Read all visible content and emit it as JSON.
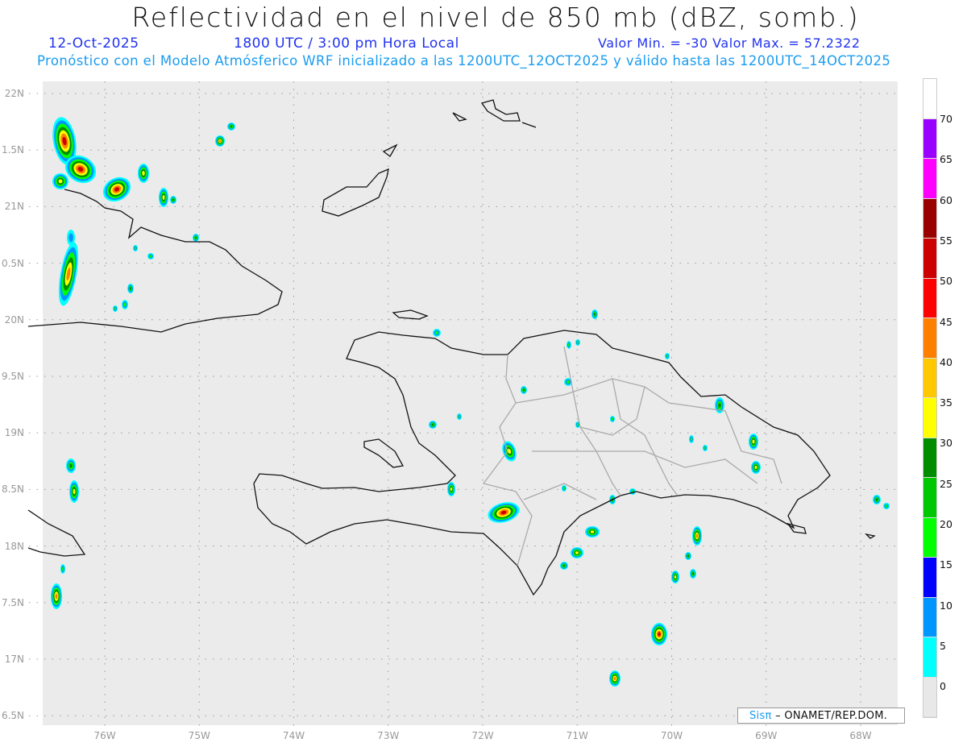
{
  "header": {
    "title": "Reflectividad en el nivel de 850 mb (dBZ, somb.)",
    "date": "12-Oct-2025",
    "time": "1800 UTC / 3:00 pm Hora Local",
    "minmax": "Valor Min. = -30  Valor Max. = 57.2322",
    "subtitle": "Pronóstico con el Modelo Atmósferico WRF inicializado a las 1200UTC_12OCT2025 y válido hasta las  1200UTC_14OCT2025"
  },
  "axes": {
    "lat_labels": [
      "22N",
      "1.5N",
      "21N",
      "0.5N",
      "20N",
      "9.5N",
      "19N",
      "8.5N",
      "18N",
      "7.5N",
      "17N",
      "6.5N"
    ],
    "lon_labels": [
      "76W",
      "75W",
      "74W",
      "73W",
      "72W",
      "71W",
      "70W",
      "69W",
      "68W"
    ]
  },
  "colorbar": {
    "labels": [
      "70",
      "65",
      "60",
      "55",
      "50",
      "45",
      "40",
      "35",
      "30",
      "25",
      "20",
      "15",
      "10",
      "5",
      "0"
    ],
    "colors": [
      "#ffffff",
      "#9900ff",
      "#ff00ff",
      "#990000",
      "#cc0000",
      "#ff0000",
      "#ff7f00",
      "#ffc800",
      "#ffff00",
      "#008c00",
      "#00c800",
      "#00ff00",
      "#0000ff",
      "#0096ff",
      "#00ffff",
      "#e8e8e8"
    ]
  },
  "credit": {
    "brand": "Sisπ",
    "text": "– ONAMET/REP.DOM."
  }
}
